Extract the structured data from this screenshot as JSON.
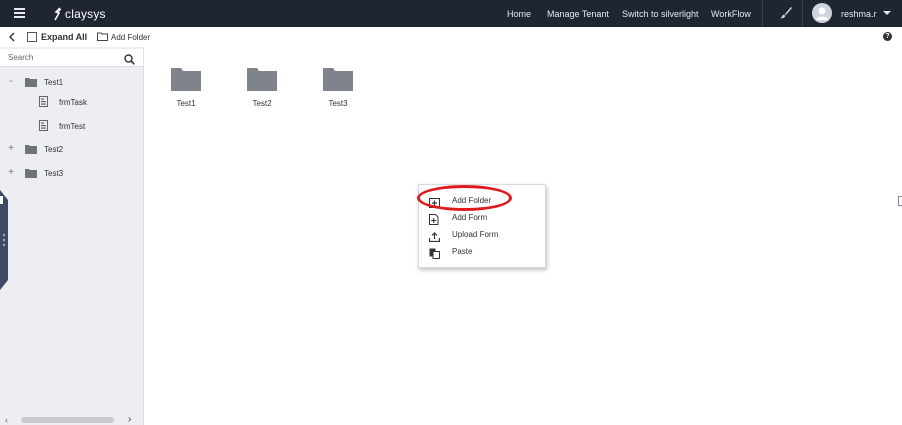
{
  "topbar": {
    "logo_text": "claysys",
    "nav": {
      "home": "Home",
      "manage_tenant": "Manage Tenant",
      "switch_silverlight": "Switch to silverlight",
      "workflow": "WorkFlow"
    },
    "username": "reshma.r"
  },
  "toolbar": {
    "expand_all": "Expand All",
    "add_folder": "Add Folder"
  },
  "sidebar": {
    "search_placeholder": "Search",
    "tree": [
      {
        "toggle": "-",
        "label": "Test1",
        "type": "folder"
      },
      {
        "label": "frmTask",
        "type": "form"
      },
      {
        "label": "frmTest",
        "type": "form"
      },
      {
        "toggle": "+",
        "label": "Test2",
        "type": "folder"
      },
      {
        "toggle": "+",
        "label": "Test3",
        "type": "folder"
      }
    ]
  },
  "content": {
    "folders": [
      {
        "label": "Test1"
      },
      {
        "label": "Test2"
      },
      {
        "label": "Test3"
      }
    ]
  },
  "context_menu": {
    "items": [
      {
        "label": "Add Folder",
        "icon": "add-folder-icon",
        "highlighted": true
      },
      {
        "label": "Add Form",
        "icon": "add-form-icon"
      },
      {
        "label": "Upload Form",
        "icon": "upload-icon"
      },
      {
        "label": "Paste",
        "icon": "paste-icon"
      }
    ]
  },
  "colors": {
    "topbar_bg": "#1f2533",
    "sidebar_bg": "#edeef1",
    "folder_gray": "#7f838b",
    "highlight_red": "#e0191d"
  }
}
